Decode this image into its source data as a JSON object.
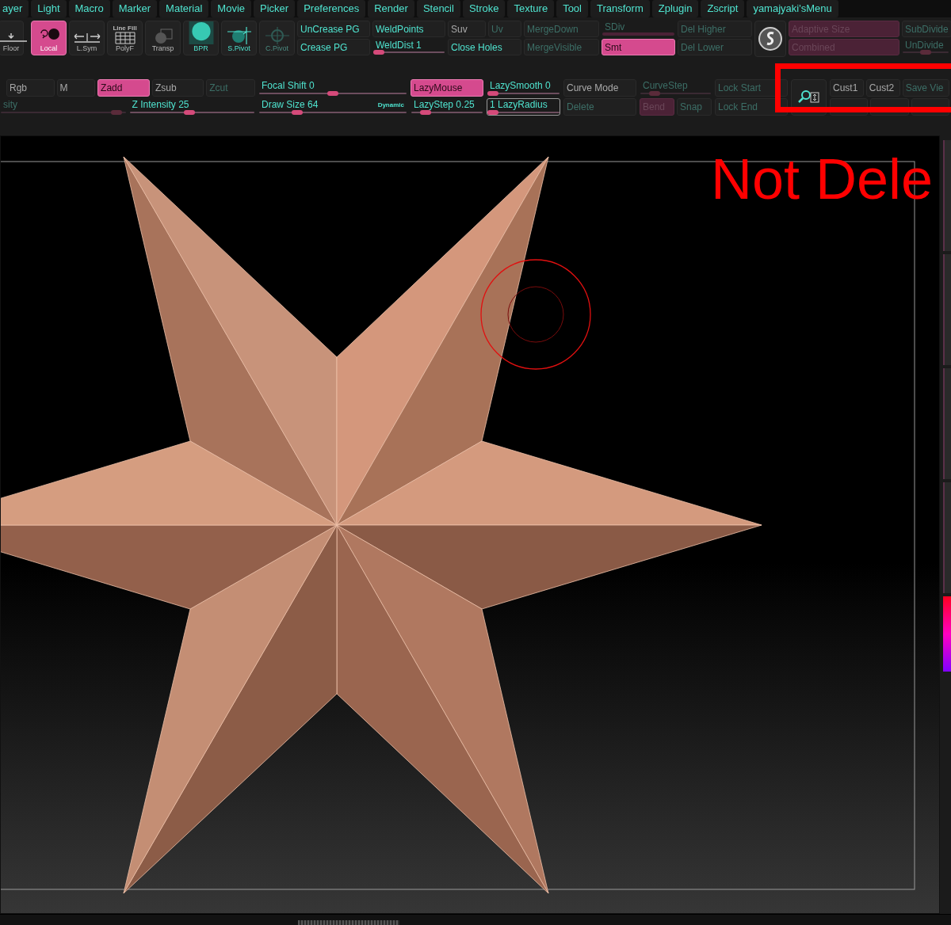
{
  "menu_bar": {
    "items": [
      "ayer",
      "Light",
      "Macro",
      "Marker",
      "Material",
      "Movie",
      "Picker",
      "Preferences",
      "Render",
      "Stencil",
      "Stroke",
      "Texture",
      "Tool",
      "Transform",
      "Zplugin",
      "Zscript",
      "yamajyaki'sMenu"
    ]
  },
  "top_tools": [
    {
      "kind": "floor",
      "label": "Floor",
      "on": false,
      "disabled": false
    },
    {
      "kind": "local",
      "label": "Local",
      "on": true,
      "disabled": false
    },
    {
      "kind": "lsym",
      "label": "L.Sym",
      "on": false,
      "disabled": false
    },
    {
      "kind": "polyf",
      "label": "PolyF",
      "caption": "Line Fill",
      "on": false,
      "disabled": false
    },
    {
      "kind": "transp",
      "label": "Transp",
      "on": false,
      "disabled": false
    },
    {
      "kind": "bpr",
      "label": "BPR",
      "on": false,
      "disabled": false
    },
    {
      "kind": "spivot",
      "label": "S.Pivot",
      "on": false,
      "disabled": false
    },
    {
      "kind": "cpivot",
      "label": "C.Pivot",
      "on": false,
      "disabled": true
    }
  ],
  "top_columns": [
    {
      "kind": "stack",
      "top": [
        {
          "kind": "button",
          "label": "UnCrease PG",
          "color": "#4fe3cf",
          "on": false,
          "disabled": false
        }
      ],
      "bottom": [
        {
          "kind": "button",
          "label": "Crease PG",
          "color": "#4fe3cf",
          "on": false,
          "disabled": false
        }
      ]
    },
    {
      "kind": "stack",
      "top": [
        {
          "kind": "button",
          "label": "WeldPoints",
          "color": "#4fe3cf",
          "on": false,
          "disabled": false
        }
      ],
      "bottom": [
        {
          "kind": "slider",
          "label": "WeldDist 1",
          "color": "#4fe3cf",
          "level": 0.08,
          "disabled": false
        }
      ]
    },
    {
      "kind": "stack",
      "top": [
        {
          "kind": "button",
          "label": "Suv",
          "color": "#a9a9a9",
          "on": false,
          "disabled": false
        },
        {
          "kind": "button",
          "label": "Uv",
          "on": false,
          "disabled": true
        }
      ],
      "bottom": [
        {
          "kind": "button",
          "label": "Close Holes",
          "color": "#4fe3cf",
          "on": false,
          "disabled": false
        }
      ]
    },
    {
      "kind": "stack",
      "top": [
        {
          "kind": "button",
          "label": "MergeDown",
          "on": false,
          "disabled": true
        }
      ],
      "bottom": [
        {
          "kind": "button",
          "label": "MergeVisible",
          "on": false,
          "disabled": true
        }
      ]
    },
    {
      "kind": "stack",
      "top": [
        {
          "kind": "slider",
          "label": "SDiv",
          "disabled": true
        }
      ],
      "bottom": [
        {
          "kind": "button",
          "label": "Smt",
          "on": true,
          "disabled": false
        }
      ]
    },
    {
      "kind": "stack",
      "top": [
        {
          "kind": "button",
          "label": "Del Higher",
          "on": false,
          "disabled": true
        }
      ],
      "bottom": [
        {
          "kind": "button",
          "label": "Del Lower",
          "on": false,
          "disabled": true
        }
      ]
    },
    {
      "kind": "icon"
    },
    {
      "kind": "stack",
      "top": [
        {
          "kind": "button",
          "label": "Adaptive Size",
          "on": true,
          "disabled": true
        }
      ],
      "bottom": [
        {
          "kind": "button",
          "label": "Combined",
          "on": true,
          "disabled": true
        }
      ]
    },
    {
      "kind": "stack",
      "top": [
        {
          "kind": "button",
          "label": "SubDivide",
          "on": false,
          "disabled": true
        }
      ],
      "bottom": [
        {
          "kind": "slider",
          "label": "UnDivide",
          "level": 0.5,
          "disabled": true
        }
      ]
    }
  ],
  "bottom_groups": [
    {
      "kind": "stack",
      "top": [
        {
          "kind": "button",
          "label": "Rgb",
          "color": "#a9a9a9",
          "on": false,
          "disabled": false
        },
        {
          "kind": "button",
          "label": "M",
          "color": "#a9a9a9",
          "on": false,
          "disabled": false
        },
        {
          "kind": "button",
          "label": "Zadd",
          "on": true,
          "disabled": false
        },
        {
          "kind": "button",
          "label": "Zsub",
          "color": "#a9a9a9",
          "on": false,
          "disabled": false
        },
        {
          "kind": "button",
          "label": "Zcut",
          "on": false,
          "disabled": true
        }
      ],
      "bottom": [
        {
          "kind": "slider",
          "label": "sity",
          "level": 0.93,
          "disabled": true
        },
        {
          "kind": "slider",
          "label": "Z Intensity 25",
          "color": "#4fe3cf",
          "level": 0.48,
          "disabled": false
        }
      ]
    },
    {
      "kind": "stack",
      "top": [
        {
          "kind": "slider",
          "label": "Focal Shift 0",
          "color": "#4fe3cf",
          "level": 0.5,
          "disabled": false
        }
      ],
      "bottom": [
        {
          "kind": "slider",
          "label": "Draw Size 64",
          "badge": "Dynamic",
          "color": "#4fe3cf",
          "level": 0.26,
          "disabled": false
        }
      ]
    },
    {
      "kind": "stack",
      "top": [
        {
          "kind": "button",
          "label": "LazyMouse",
          "on": true,
          "disabled": false
        }
      ],
      "bottom": [
        {
          "kind": "slider",
          "label": "LazyStep 0.25",
          "color": "#4fe3cf",
          "level": 0.2,
          "disabled": false
        }
      ]
    },
    {
      "kind": "stack",
      "top": [
        {
          "kind": "slider",
          "label": "LazySmooth 0",
          "color": "#4fe3cf",
          "level": 0.08,
          "disabled": false
        }
      ],
      "bottom": [
        {
          "kind": "slider",
          "label": "1 LazyRadius",
          "color": "#4fe3cf",
          "level": 0.08,
          "disabled": false,
          "outlined": true
        }
      ]
    },
    {
      "kind": "stack",
      "top": [
        {
          "kind": "button",
          "label": "Curve Mode",
          "color": "#a9a9a9",
          "on": false,
          "disabled": false
        }
      ],
      "bottom": [
        {
          "kind": "button",
          "label": "Delete",
          "on": false,
          "disabled": true
        }
      ]
    },
    {
      "kind": "stack",
      "top": [
        {
          "kind": "slider",
          "label": "CurveStep",
          "level": 0.2,
          "disabled": true
        }
      ],
      "bottom": [
        {
          "kind": "button",
          "label": "Bend",
          "on": true,
          "disabled": true
        },
        {
          "kind": "button",
          "label": "Snap",
          "on": false,
          "disabled": true
        }
      ]
    },
    {
      "kind": "stack",
      "top": [
        {
          "kind": "button",
          "label": "Lock Start",
          "on": false,
          "disabled": true
        }
      ],
      "bottom": [
        {
          "kind": "button",
          "label": "Lock End",
          "on": false,
          "disabled": true
        }
      ]
    },
    {
      "kind": "icon"
    },
    {
      "kind": "stack",
      "top": [
        {
          "kind": "button",
          "label": "Cust1",
          "color": "#a9a9a9",
          "on": false,
          "disabled": false
        },
        {
          "kind": "button",
          "label": "Cust2",
          "color": "#a9a9a9",
          "on": false,
          "disabled": false
        },
        {
          "kind": "button",
          "label": "Save Vie",
          "on": false,
          "disabled": true
        }
      ],
      "bottom": [
        {
          "kind": "blank"
        },
        {
          "kind": "blank"
        },
        {
          "kind": "blank"
        }
      ]
    }
  ],
  "annotation": {
    "text": "Not Dele"
  }
}
